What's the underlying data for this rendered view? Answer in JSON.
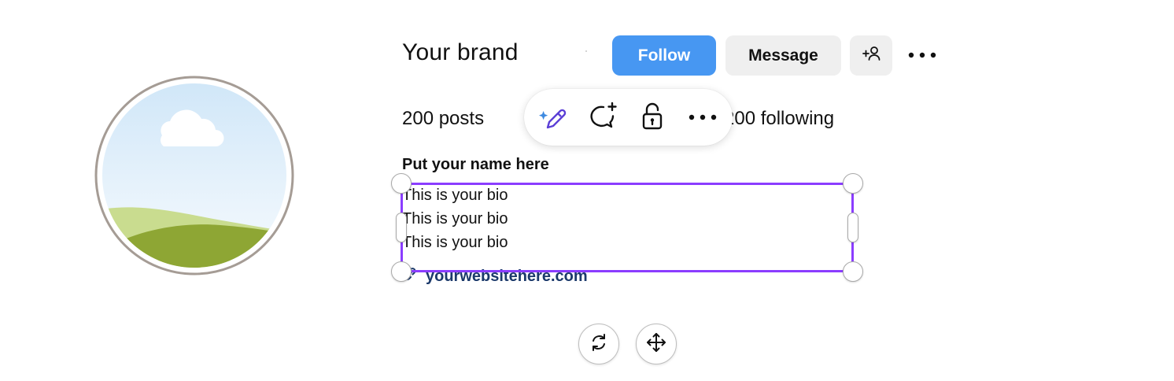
{
  "profile": {
    "username": "Your brand",
    "follow_label": "Follow",
    "message_label": "Message",
    "posts": "200 posts",
    "following": "200 following",
    "name": "Put your name here",
    "bio": [
      "This is your bio",
      "This is your bio",
      "This is your bio"
    ],
    "website": "yourwebsitehere.com"
  },
  "icons": {
    "add_user": "add-user-icon",
    "more": "more-horizontal-icon",
    "edit_magic": "magic-pen-icon",
    "comment": "comment-add-icon",
    "lock": "unlock-icon",
    "link": "link-icon",
    "rotate": "rotate-icon",
    "move": "move-icon"
  },
  "colors": {
    "follow": "#4797f2",
    "message": "#efefef",
    "selection": "#8b3dff",
    "link_text": "#1c3a6b"
  }
}
